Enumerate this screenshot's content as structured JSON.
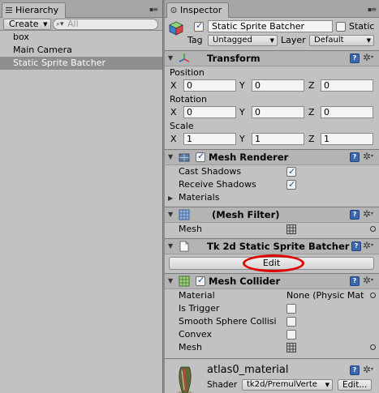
{
  "hierarchy": {
    "tab_label": "Hierarchy",
    "create_label": "Create",
    "search_placeholder": "All",
    "items": [
      "box",
      "Main Camera",
      "Static Sprite Batcher"
    ],
    "selected_index": 2
  },
  "inspector": {
    "tab_label": "Inspector",
    "object_name": "Static Sprite Batcher",
    "active": true,
    "static_label": "Static",
    "static_checked": false,
    "tag_label": "Tag",
    "tag_value": "Untagged",
    "layer_label": "Layer",
    "layer_value": "Default",
    "transform": {
      "title": "Transform",
      "position_label": "Position",
      "rotation_label": "Rotation",
      "scale_label": "Scale",
      "axes": [
        "X",
        "Y",
        "Z"
      ],
      "position": [
        "0",
        "0",
        "0"
      ],
      "rotation": [
        "0",
        "0",
        "0"
      ],
      "scale": [
        "1",
        "1",
        "1"
      ]
    },
    "mesh_renderer": {
      "title": "Mesh Renderer",
      "enabled": true,
      "cast_shadows_label": "Cast Shadows",
      "cast_shadows": true,
      "receive_shadows_label": "Receive Shadows",
      "receive_shadows": true,
      "materials_label": "Materials"
    },
    "mesh_filter": {
      "title": "(Mesh Filter)",
      "mesh_label": "Mesh"
    },
    "sprite_batcher": {
      "title": "Tk 2d Static Sprite Batcher",
      "edit_label": "Edit"
    },
    "mesh_collider": {
      "title": "Mesh Collider",
      "enabled": true,
      "material_label": "Material",
      "material_value": "None (Physic Mat",
      "is_trigger_label": "Is Trigger",
      "smooth_label": "Smooth Sphere Collisi",
      "convex_label": "Convex",
      "mesh_label": "Mesh"
    },
    "material": {
      "name": "atlas0_material",
      "shader_label": "Shader",
      "shader_value": "tk2d/PremulVerte",
      "edit_label": "Edit..."
    }
  },
  "colors": {
    "panel_bg": "#c2c2c2",
    "selection_bg": "#8e8e8e",
    "header_bg": "#b4b4b4",
    "annotation_red": "#e00000",
    "check_blue": "#1c4fa3"
  }
}
